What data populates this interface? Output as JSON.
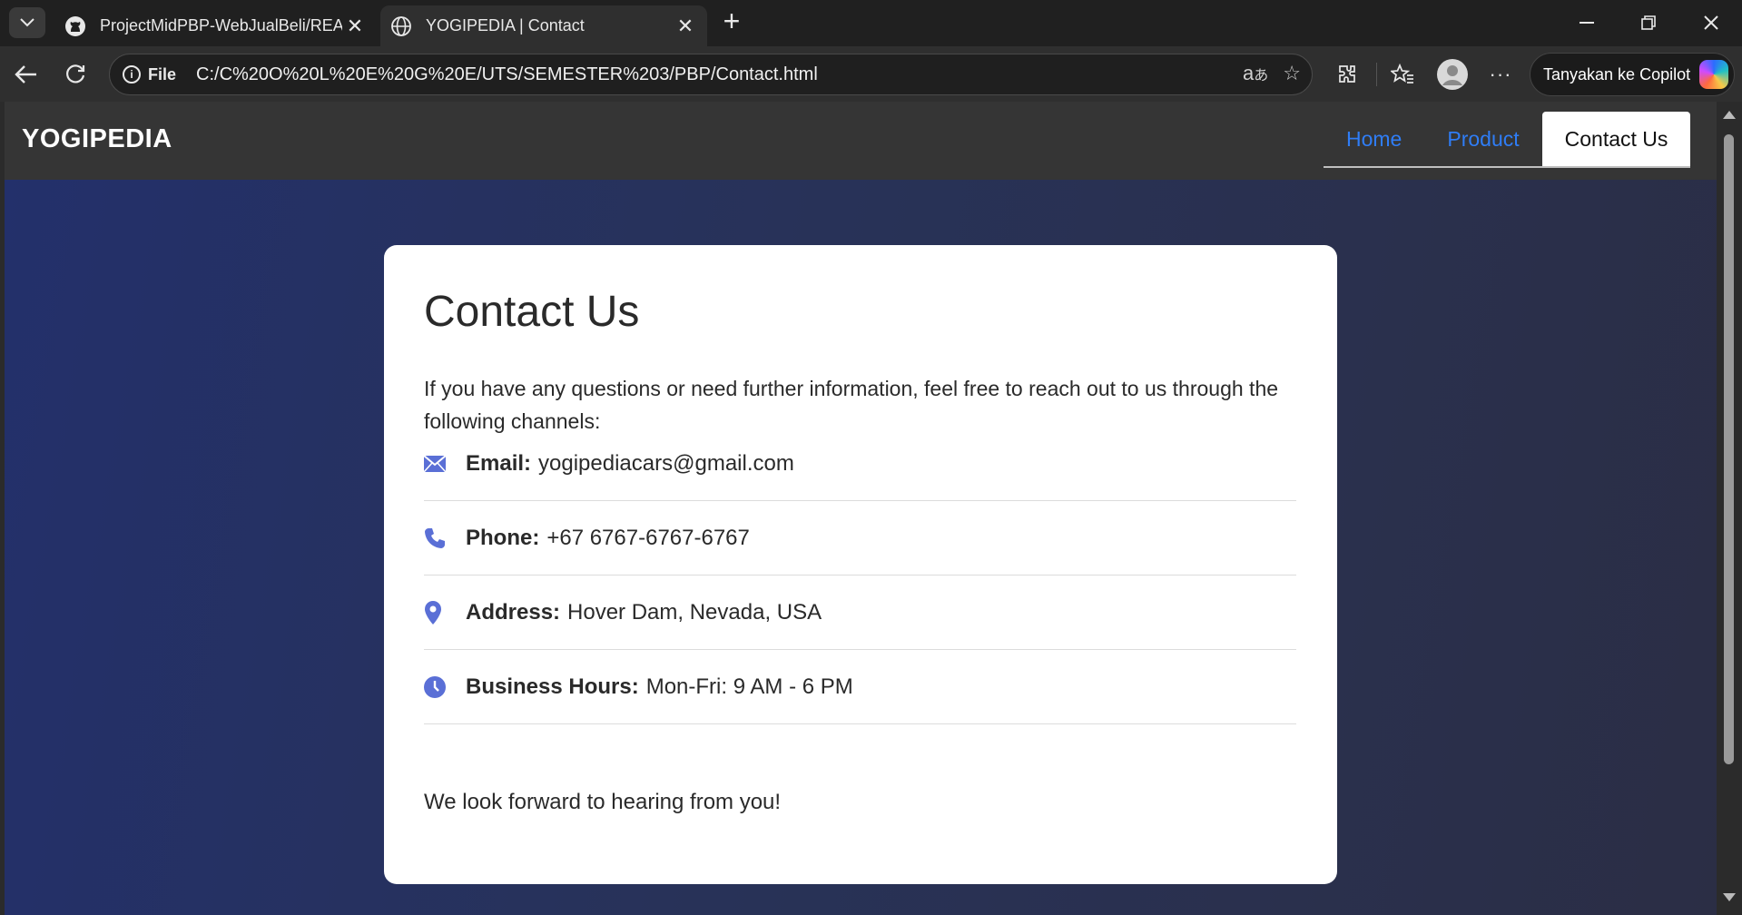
{
  "browser": {
    "tabs": [
      {
        "title": "ProjectMidPBP-WebJualBeli/READ",
        "icon": "github-icon",
        "active": false
      },
      {
        "title": "YOGIPEDIA | Contact",
        "icon": "globe-icon",
        "active": true
      }
    ],
    "address": {
      "scheme_label": "File",
      "url": "C:/C%20O%20L%20E%20G%20E/UTS/SEMESTER%203/PBP/Contact.html"
    },
    "copilot_label": "Tanyakan ke Copilot"
  },
  "site": {
    "brand": "YOGIPEDIA",
    "nav": [
      {
        "label": "Home",
        "active": false
      },
      {
        "label": "Product",
        "active": false
      },
      {
        "label": "Contact Us",
        "active": true
      }
    ]
  },
  "contact": {
    "title": "Contact Us",
    "intro": "If you have any questions or need further information, feel free to reach out to us through the following channels:",
    "items": [
      {
        "icon": "envelope-icon",
        "label": "Email:",
        "value": "yogipediacars@gmail.com"
      },
      {
        "icon": "phone-icon",
        "label": "Phone:",
        "value": "+67 6767-6767-6767"
      },
      {
        "icon": "location-pin-icon",
        "label": "Address:",
        "value": "Hover Dam, Nevada, USA"
      },
      {
        "icon": "clock-icon",
        "label": "Business Hours:",
        "value": "Mon-Fri: 9 AM - 6 PM"
      }
    ],
    "closing": "We look forward to hearing from you!"
  },
  "colors": {
    "nav_link": "#2f7df6",
    "icon_accent": "#5a6fd6",
    "hero_start": "#23306b",
    "hero_end": "#2b2e45"
  }
}
